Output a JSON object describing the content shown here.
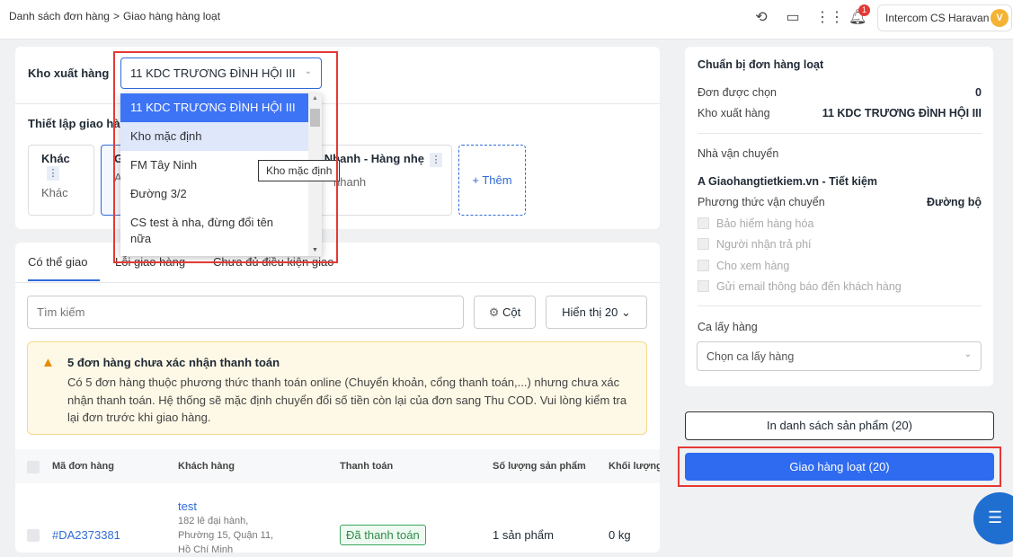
{
  "breadcrumb": {
    "parent": "Danh sách đơn hàng",
    "sep": ">",
    "current": "Giao hàng hàng loạt"
  },
  "header": {
    "notifications": "1",
    "user_name": "Intercom CS Haravan",
    "avatar": "V"
  },
  "warehouse": {
    "label": "Kho xuất hàng",
    "selected": "11 KDC TRƯƠNG ĐÌNH HỘI III",
    "options": [
      "11 KDC TRƯƠNG ĐÌNH HỘI III",
      "Kho mặc định",
      "FM Tây Ninh",
      "Đường 3/2",
      "CS test à nha, đừng đổi tên nữa"
    ],
    "tooltip": "Kho mặc định"
  },
  "shipping_setup": {
    "title": "Thiết lập giao hàng",
    "cards": [
      {
        "title": "Khác",
        "sub": "Khác"
      },
      {
        "title": "G",
        "sub": "A"
      },
      {
        "title": "Nhanh - Hàng nhẹ",
        "sub": "nhanh"
      }
    ],
    "add": "+ Thêm"
  },
  "tabs": [
    "Có thể giao",
    "Lỗi giao hàng",
    "Chưa đủ điều kiện giao"
  ],
  "toolbar": {
    "search_placeholder": "Tìm kiếm",
    "columns": "Cột",
    "show": "Hiển thị 20"
  },
  "alert": {
    "title": "5 đơn hàng chưa xác nhận thanh toán",
    "body": "Có 5 đơn hàng thuộc phương thức thanh toán online (Chuyển khoản, cổng thanh toán,...) nhưng chưa xác nhận thanh toán. Hệ thống sẽ mặc định chuyển đổi số tiền còn lại của đơn sang Thu COD. Vui lòng kiểm tra lại đơn trước khi giao hàng."
  },
  "table": {
    "headers": [
      "Mã đơn hàng",
      "Khách hàng",
      "Thanh toán",
      "Số lượng sản phẩm",
      "Khối lượng"
    ],
    "rows": [
      {
        "id": "#DA2373381",
        "customer": "test",
        "address": [
          "182 lê đại hành,",
          "Phường 15, Quận 11,",
          "Hồ Chí Minh"
        ],
        "payment": "Đã thanh toán",
        "qty": "1 sản phẩm",
        "weight": "0 kg"
      }
    ]
  },
  "summary": {
    "title": "Chuẩn bị đơn hàng loạt",
    "selected_label": "Đơn được chọn",
    "selected": "0",
    "warehouse_label": "Kho xuất hàng",
    "warehouse": "11 KDC TRƯƠNG ĐÌNH HỘI III",
    "carrier_label": "Nhà vận chuyển",
    "carrier": "A Giaohangtietkiem.vn - Tiết kiệm",
    "method_label": "Phương thức vận chuyển",
    "method": "Đường bộ",
    "options": [
      "Bảo hiểm hàng hóa",
      "Người nhận trả phí",
      "Cho xem hàng",
      "Gửi email thông báo đến khách hàng"
    ],
    "shift_label": "Ca lấy hàng",
    "shift_placeholder": "Chọn ca lấy hàng"
  },
  "actions": {
    "print": "In danh sách sản phẩm (20)",
    "ship": "Giao hàng loạt (20)"
  }
}
